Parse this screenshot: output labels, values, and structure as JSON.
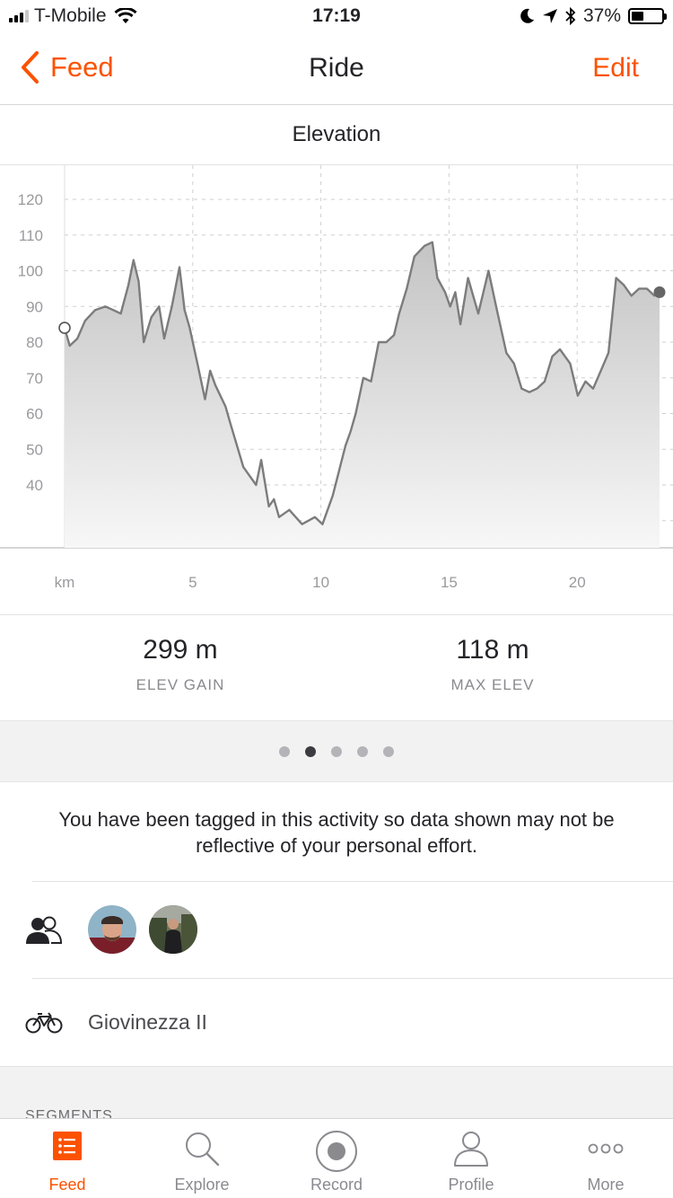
{
  "status_bar": {
    "carrier": "T-Mobile",
    "time": "17:19",
    "battery": "37%"
  },
  "nav": {
    "back_label": "Feed",
    "title": "Ride",
    "edit_label": "Edit"
  },
  "elevation": {
    "section_title": "Elevation"
  },
  "chart_data": {
    "type": "area",
    "xlabel": "km",
    "x_ticks": [
      "5",
      "10",
      "15",
      "20"
    ],
    "y_ticks": [
      "120",
      "110",
      "100",
      "90",
      "80",
      "70",
      "60",
      "50",
      "40"
    ],
    "xlim": [
      0,
      23.3
    ],
    "ylim": [
      20,
      130
    ],
    "grid": true,
    "x": [
      0.0,
      0.2,
      0.5,
      0.8,
      1.2,
      1.6,
      1.9,
      2.2,
      2.5,
      2.7,
      2.9,
      3.1,
      3.4,
      3.7,
      3.9,
      4.2,
      4.5,
      4.7,
      4.9,
      5.2,
      5.5,
      5.7,
      5.9,
      6.3,
      6.5,
      7.0,
      7.5,
      7.7,
      8.0,
      8.2,
      8.4,
      8.8,
      9.3,
      9.8,
      10.1,
      10.5,
      11.0,
      11.2,
      11.4,
      11.7,
      12.0,
      12.3,
      12.6,
      12.9,
      13.1,
      13.4,
      13.7,
      14.1,
      14.4,
      14.6,
      14.9,
      15.1,
      15.3,
      15.5,
      15.8,
      16.2,
      16.6,
      16.9,
      17.3,
      17.6,
      17.9,
      18.2,
      18.5,
      18.8,
      19.1,
      19.4,
      19.8,
      20.1,
      20.4,
      20.7,
      21.0,
      21.3,
      21.6,
      21.9,
      22.2,
      22.5,
      22.8,
      23.1,
      23.3
    ],
    "y": [
      84,
      79,
      81,
      86,
      89,
      90,
      89,
      88,
      96,
      103,
      97,
      80,
      87,
      90,
      81,
      90,
      101,
      89,
      84,
      74,
      64,
      72,
      68,
      62,
      57,
      45,
      40,
      47,
      34,
      36,
      31,
      33,
      29,
      31,
      29,
      37,
      51,
      55,
      60,
      70,
      69,
      80,
      80,
      82,
      88,
      95,
      104,
      107,
      108,
      98,
      94,
      90,
      94,
      85,
      98,
      88,
      100,
      90,
      77,
      74,
      67,
      66,
      67,
      69,
      76,
      78,
      74,
      65,
      69,
      67,
      72,
      77,
      98,
      96,
      93,
      95,
      95,
      93,
      94,
      94,
      91,
      87,
      96
    ]
  },
  "stats": [
    {
      "value": "299 m",
      "label": "ELEV GAIN"
    },
    {
      "value": "118 m",
      "label": "MAX ELEV"
    }
  ],
  "pager": {
    "count": 5,
    "active": 1
  },
  "tag_message": "You have been tagged in this activity so data shown may not be reflective of your personal effort.",
  "gear": {
    "bike_name": "Giovinezza II"
  },
  "segments": {
    "label": "SEGMENTS"
  },
  "tabbar": {
    "tabs": [
      {
        "label": "Feed",
        "icon": "feed-icon",
        "active": true
      },
      {
        "label": "Explore",
        "icon": "search-icon",
        "active": false
      },
      {
        "label": "Record",
        "icon": "record-icon",
        "active": false
      },
      {
        "label": "Profile",
        "icon": "profile-icon",
        "active": false
      },
      {
        "label": "More",
        "icon": "more-icon",
        "active": false
      }
    ]
  },
  "colors": {
    "accent": "#fc5200",
    "text": "#242428",
    "muted": "#8a8a8f",
    "chart_line": "#7c7c7c"
  }
}
